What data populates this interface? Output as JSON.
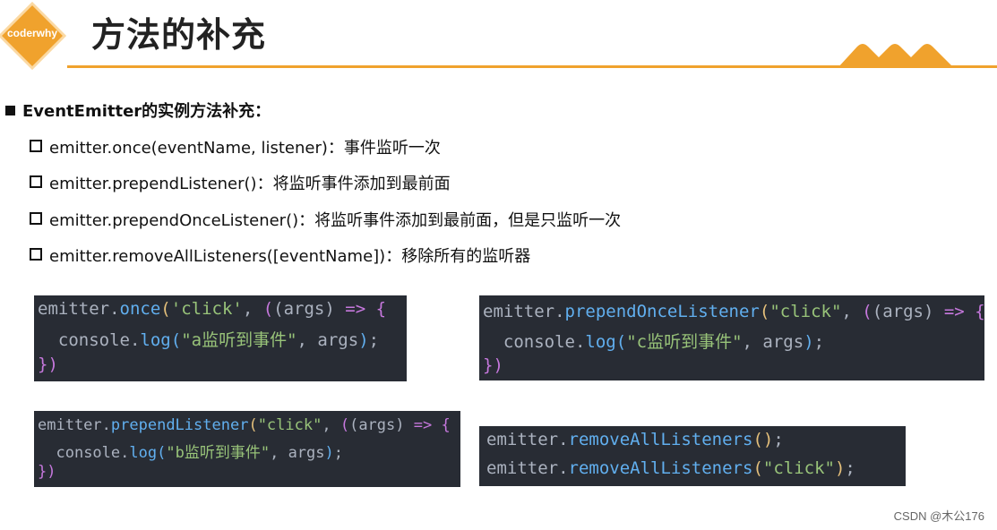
{
  "header": {
    "logo_text": "coderwhy",
    "title": "方法的补充"
  },
  "section": {
    "heading": "EventEmitter的实例方法补充："
  },
  "items": [
    "emitter.once(eventName, listener)：事件监听一次",
    "emitter.prependListener()：将监听事件添加到最前面",
    "emitter.prependOnceListener()：将监听事件添加到最前面，但是只监听一次",
    "emitter.removeAllListeners([eventName])：移除所有的监听器"
  ],
  "code_blocks": {
    "once": {
      "l1_obj": "emitter",
      "l1_method": "once",
      "l1_arg": "'click'",
      "l1_params": "(args)",
      "l1_arrow": "=>",
      "l2_obj": "console",
      "l2_method": "log",
      "l2_str": "\"a监听到事件\"",
      "l2_arg": "args",
      "l3": "})"
    },
    "prepend_once": {
      "l1_obj": "emitter",
      "l1_method": "prependOnceListener",
      "l1_arg": "\"click\"",
      "l1_params": "(args)",
      "l1_arrow": "=>",
      "l2_obj": "console",
      "l2_method": "log",
      "l2_str": "\"c监听到事件\"",
      "l2_arg": "args",
      "l3": "})"
    },
    "prepend": {
      "l1_obj": "emitter",
      "l1_method": "prependListener",
      "l1_arg": "\"click\"",
      "l1_params": "(args)",
      "l1_arrow": "=>",
      "l2_obj": "console",
      "l2_method": "log",
      "l2_str": "\"b监听到事件\"",
      "l2_arg": "args",
      "l3": "})"
    },
    "remove_all": {
      "l1_obj": "emitter",
      "l1_method": "removeAllListeners",
      "l2_obj": "emitter",
      "l2_method": "removeAllListeners",
      "l2_str": "\"click\""
    }
  },
  "watermark": "CSDN @木公176",
  "colors": {
    "accent": "#f0a22d",
    "code_bg": "#282c34"
  }
}
